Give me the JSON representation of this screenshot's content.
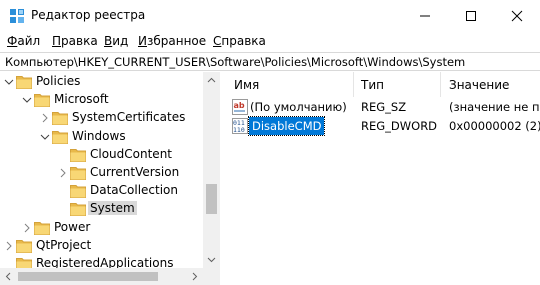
{
  "window": {
    "title": "Редактор реестра"
  },
  "menu": [
    {
      "accel": "Ф",
      "rest": "айл"
    },
    {
      "accel": "П",
      "rest": "равка"
    },
    {
      "accel": "В",
      "rest": "ид"
    },
    {
      "accel": "И",
      "rest": "збранное"
    },
    {
      "accel": "С",
      "rest": "правка"
    }
  ],
  "address": "Компьютер\\HKEY_CURRENT_USER\\Software\\Policies\\Microsoft\\Windows\\System",
  "tree": [
    {
      "label": "Policies",
      "expander": "expanded",
      "level": 0
    },
    {
      "label": "Microsoft",
      "expander": "expanded",
      "level": 1
    },
    {
      "label": "SystemCertificates",
      "expander": "collapsed",
      "level": 2
    },
    {
      "label": "Windows",
      "expander": "expanded",
      "level": 2
    },
    {
      "label": "CloudContent",
      "expander": "none",
      "level": 3
    },
    {
      "label": "CurrentVersion",
      "expander": "collapsed",
      "level": 3
    },
    {
      "label": "DataCollection",
      "expander": "none",
      "level": 3
    },
    {
      "label": "System",
      "expander": "none",
      "level": 3,
      "selected": true
    },
    {
      "label": "Power",
      "expander": "collapsed",
      "level": 1
    },
    {
      "label": "QtProject",
      "expander": "collapsed",
      "level": 0
    },
    {
      "label": "RegisteredApplications",
      "expander": "none",
      "level": 0
    }
  ],
  "list": {
    "columns": [
      "Имя",
      "Тип",
      "Значение"
    ],
    "rows": [
      {
        "icon": "string-value-icon",
        "name": "(По умолчанию)",
        "type": "REG_SZ",
        "value": "(значение не пр"
      },
      {
        "icon": "binary-value-icon",
        "name": "DisableCMD",
        "type": "REG_DWORD",
        "value": "0x00000002 (2)",
        "selected": true
      }
    ]
  },
  "colors": {
    "selection": "#0078d7",
    "folder": "#f8d775",
    "tree_selection": "#d9d9d9"
  }
}
